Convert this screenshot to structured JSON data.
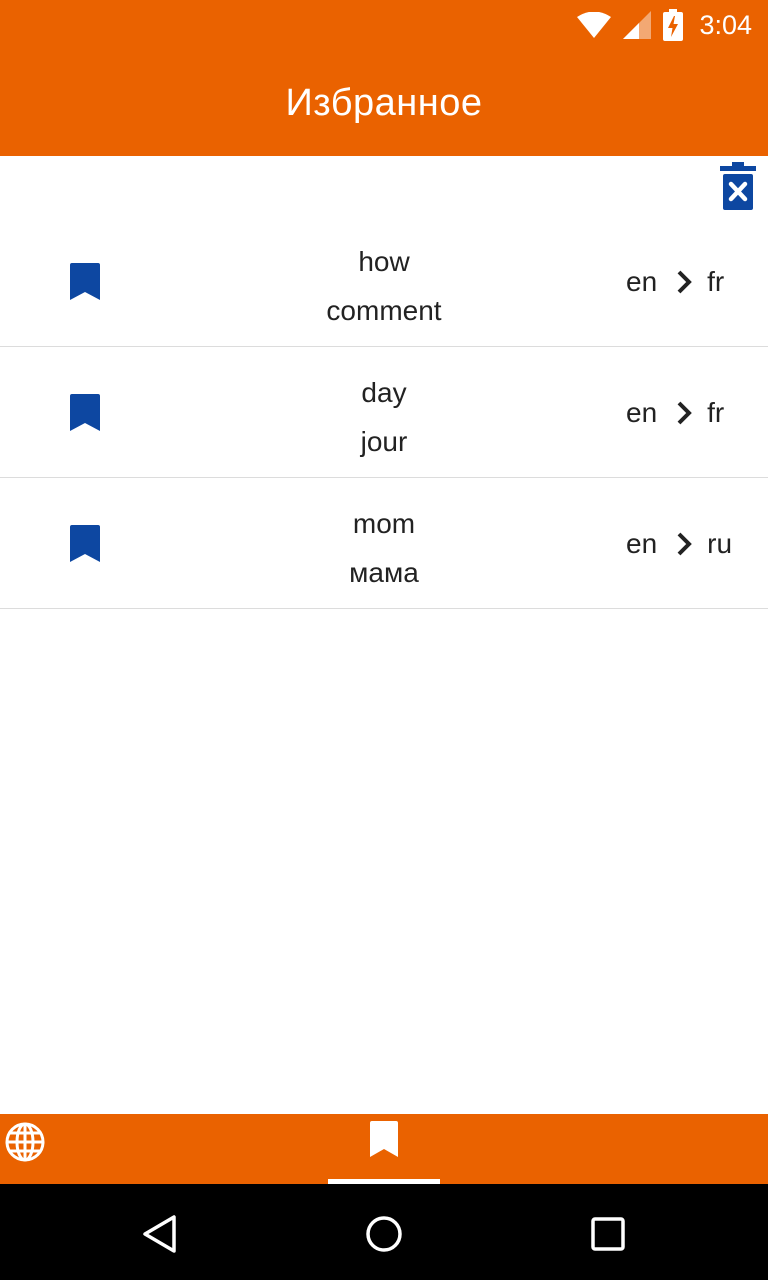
{
  "status_bar": {
    "time": "3:04"
  },
  "app_bar": {
    "title": "Избранное"
  },
  "favorites": [
    {
      "source": "how",
      "target": "comment",
      "from_lang": "en",
      "to_lang": "fr"
    },
    {
      "source": "day",
      "target": "jour",
      "from_lang": "en",
      "to_lang": "fr"
    },
    {
      "source": "mom",
      "target": "мама",
      "from_lang": "en",
      "to_lang": "ru"
    }
  ],
  "icons": {
    "clear": "trash-x-icon",
    "row": "bookmark-icon",
    "arrow": "chevron-right-icon",
    "nav_translate": "globe-icon",
    "nav_favorites": "bookmark-icon"
  },
  "colors": {
    "primary": "#ea6200",
    "accent": "#0d47a1",
    "divider": "#dcdcdc",
    "system_nav": "#000000"
  }
}
